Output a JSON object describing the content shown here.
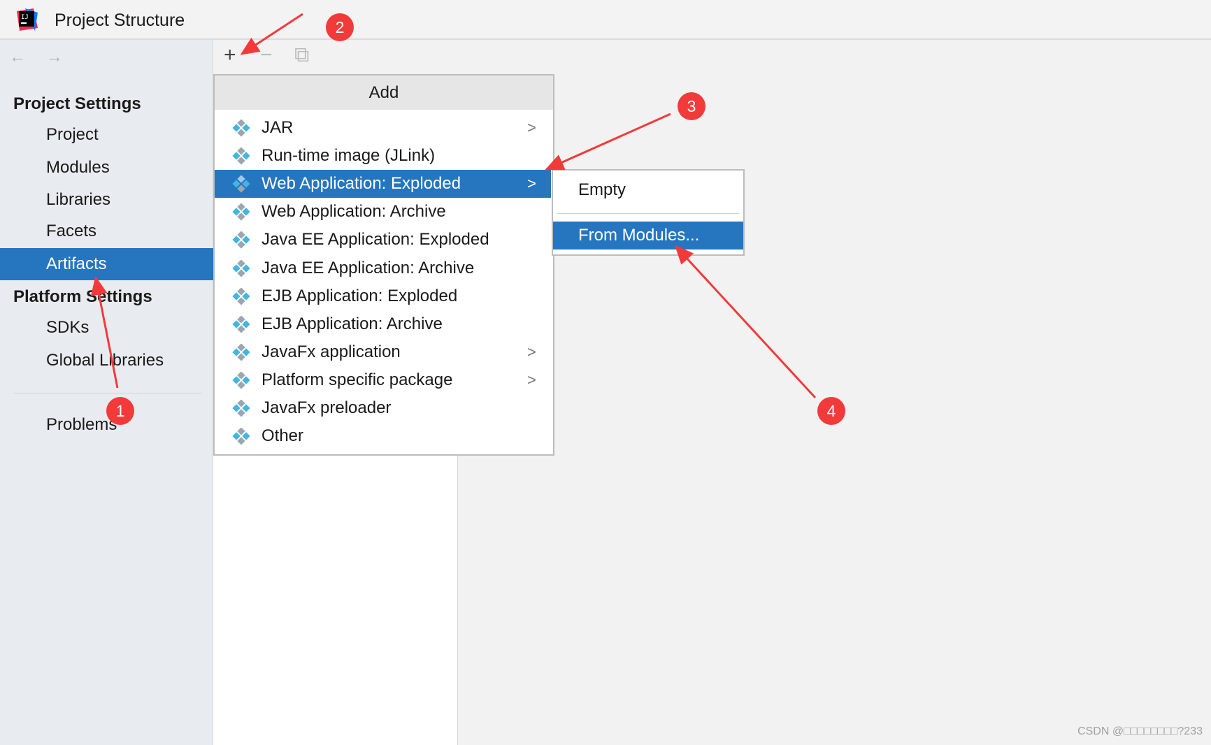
{
  "window": {
    "title": "Project Structure"
  },
  "nav": {
    "back": "←",
    "forward": "→"
  },
  "toolbar": {
    "add": "+",
    "remove": "−",
    "copy": "⧉"
  },
  "sidebar": {
    "project_settings": "Project Settings",
    "project_items": [
      {
        "label": "Project"
      },
      {
        "label": "Modules"
      },
      {
        "label": "Libraries"
      },
      {
        "label": "Facets"
      },
      {
        "label": "Artifacts",
        "selected": true
      }
    ],
    "platform_settings": "Platform Settings",
    "platform_items": [
      {
        "label": "SDKs"
      },
      {
        "label": "Global Libraries"
      }
    ],
    "problems": "Problems"
  },
  "popup": {
    "title": "Add",
    "items": [
      {
        "label": "JAR",
        "submenu": true
      },
      {
        "label": "Run-time image (JLink)"
      },
      {
        "label": "Web Application: Exploded",
        "submenu": true,
        "highlighted": true
      },
      {
        "label": "Web Application: Archive"
      },
      {
        "label": "Java EE Application: Exploded"
      },
      {
        "label": "Java EE Application: Archive"
      },
      {
        "label": "EJB Application: Exploded"
      },
      {
        "label": "EJB Application: Archive"
      },
      {
        "label": "JavaFx application",
        "submenu": true
      },
      {
        "label": "Platform specific package",
        "submenu": true
      },
      {
        "label": "JavaFx preloader"
      },
      {
        "label": "Other"
      }
    ],
    "chevron": ">"
  },
  "submenu": {
    "items": [
      {
        "label": "Empty"
      },
      {
        "label": "From Modules...",
        "highlighted": true
      }
    ]
  },
  "annotations": [
    "1",
    "2",
    "3",
    "4"
  ],
  "watermark": "CSDN @□□□□□□□□?233",
  "colors": {
    "selection": "#2675bf",
    "annotation": "#f33a3a"
  }
}
